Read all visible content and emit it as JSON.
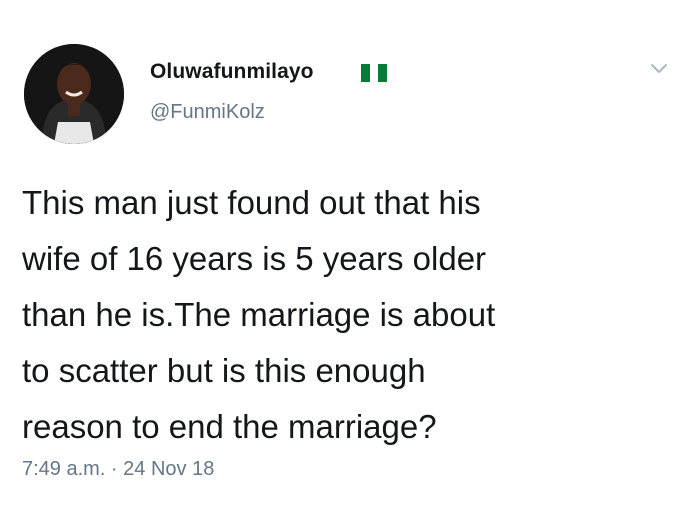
{
  "author": {
    "display_name": "Oluwafunmilayo",
    "handle": "@FunmiKolz",
    "flag_icon": "nigeria-flag-icon",
    "flag_colors": [
      "#0a7a3a",
      "#ffffff",
      "#0a7a3a"
    ]
  },
  "menu": {
    "icon": "chevron-down-icon"
  },
  "tweet": {
    "lines": [
      "This man just found out that his",
      "wife of 16 years is 5 years older",
      "than he is.The marriage is about",
      "to scatter but is this enough",
      "reason to end the marriage?"
    ],
    "timestamp": "7:49 a.m. · 24 Nov 18"
  },
  "colors": {
    "text": "#14171a",
    "secondary": "#657786",
    "chevron": "#aab8c2"
  }
}
